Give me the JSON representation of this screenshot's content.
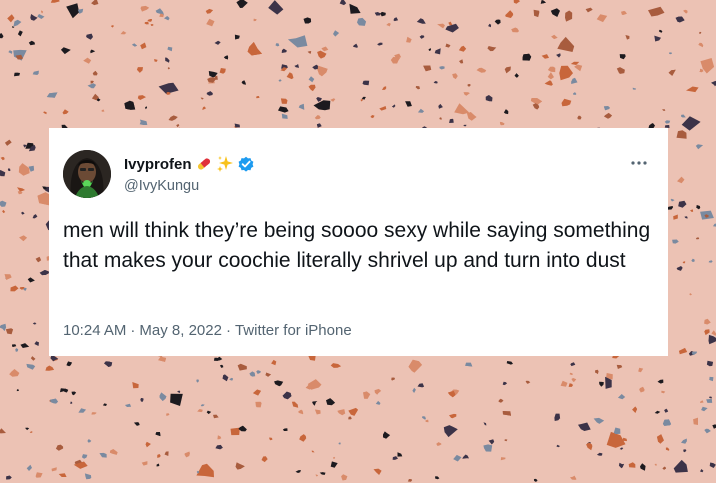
{
  "tweet": {
    "display_name": "Ivyprofen",
    "name_emojis": [
      "pill-emoji",
      "sparkles-emoji"
    ],
    "verified": true,
    "handle": "@IvyKungu",
    "text": "men will think they’re being soooo sexy while saying something that makes your coochie literally shrivel up and turn into dust",
    "time": "10:24 AM",
    "separator": "·",
    "date": "May 8, 2022",
    "source": "Twitter for iPhone"
  },
  "colors": {
    "background": "#ecc2b4",
    "card": "#ffffff",
    "text_primary": "#0f1419",
    "text_secondary": "#536471",
    "verified_badge": "#1d9bf0",
    "speckles": [
      "#3c3348",
      "#c8663b",
      "#7a8aa0",
      "#1c1a1f",
      "#d98b6a",
      "#a85c3e"
    ]
  }
}
